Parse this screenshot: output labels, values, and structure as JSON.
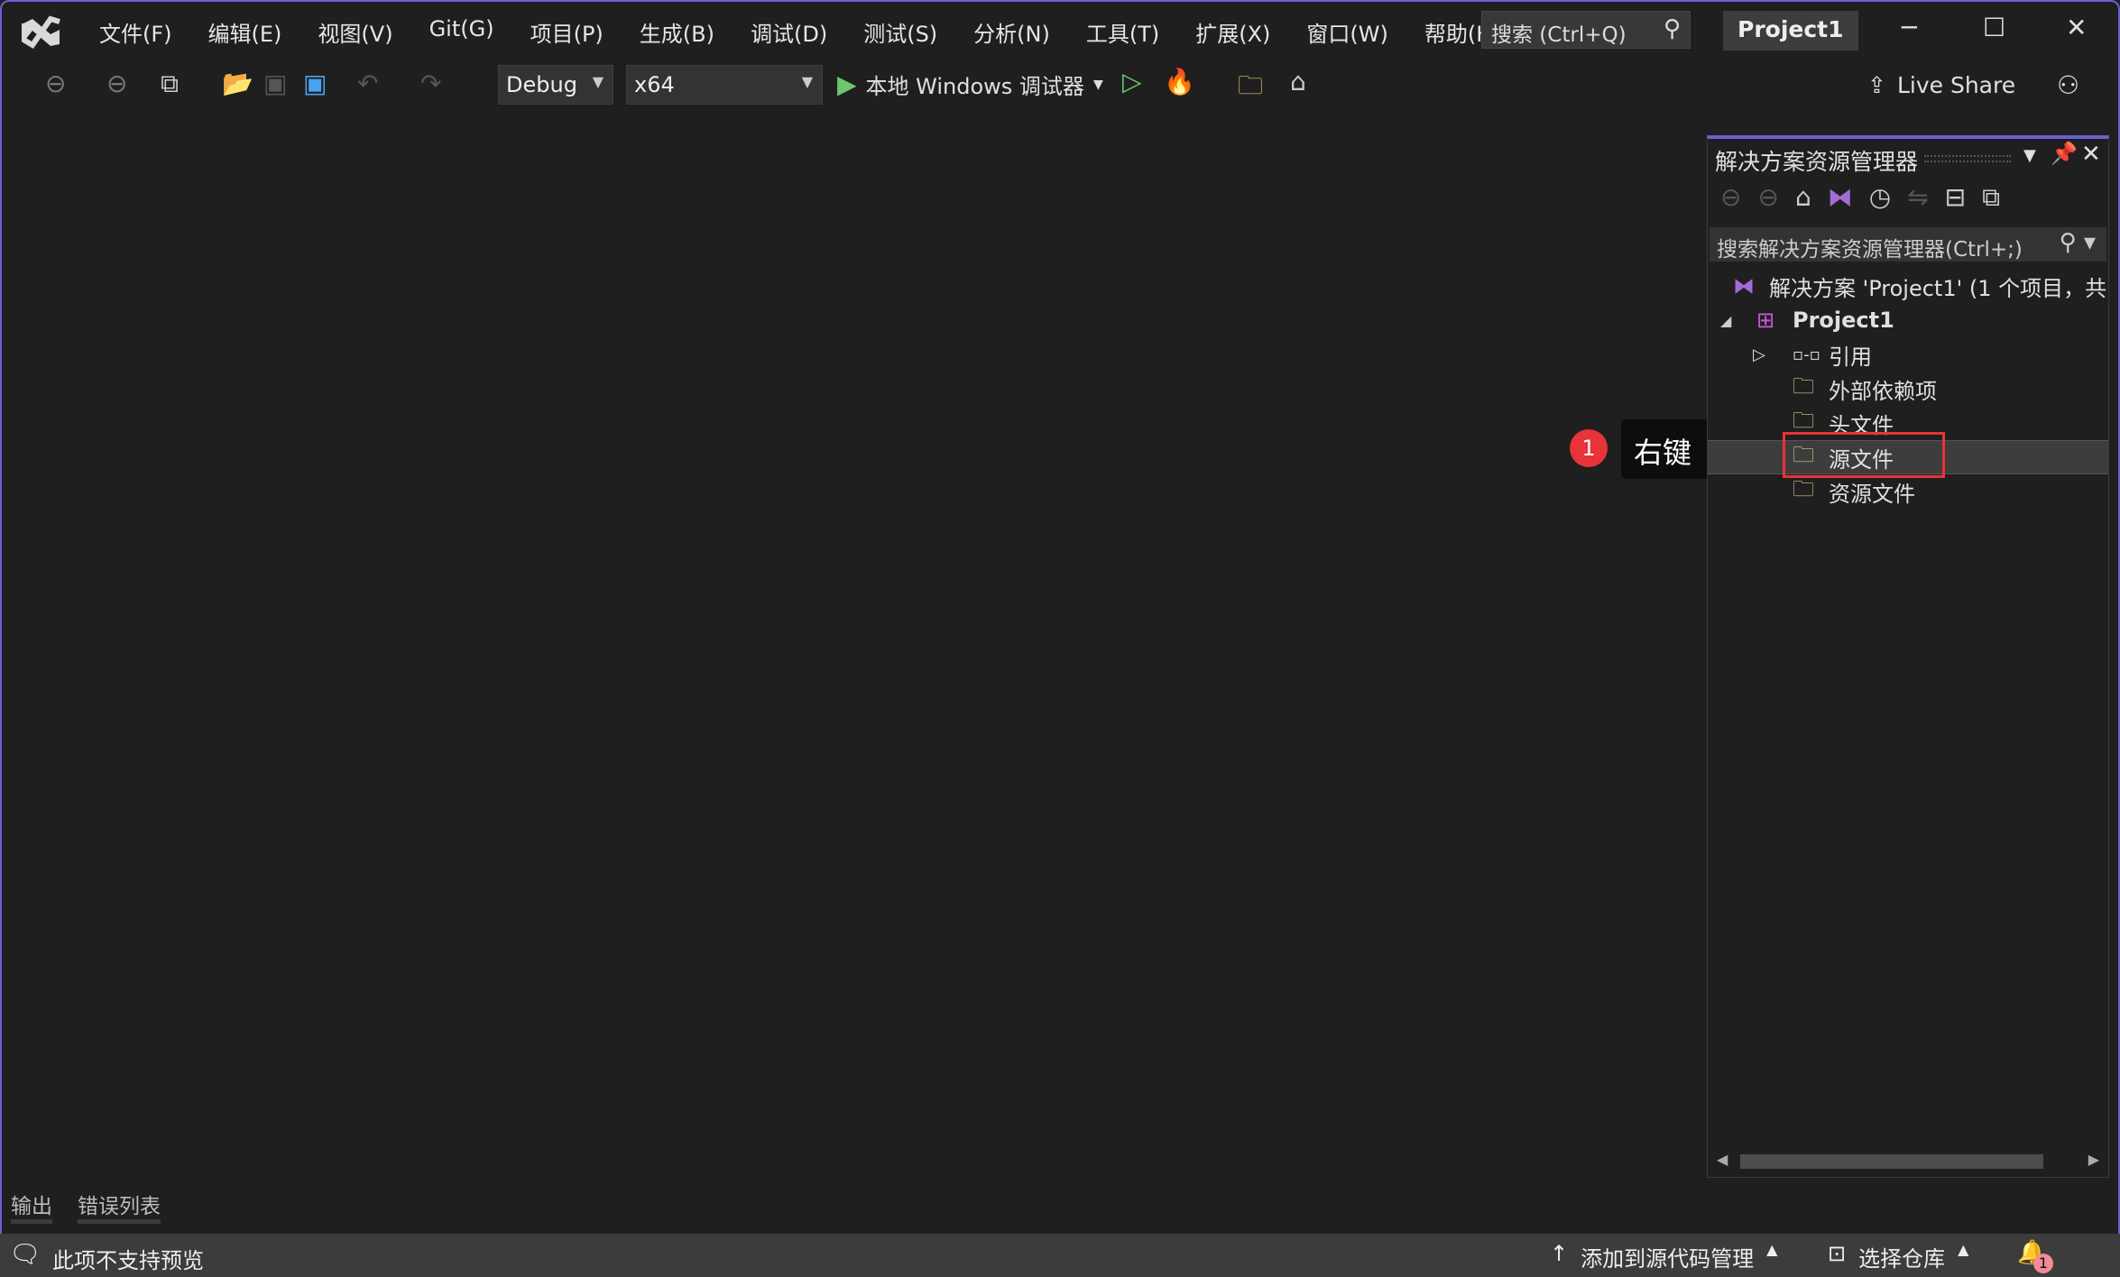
{
  "menu": {
    "items": [
      "文件(F)",
      "编辑(E)",
      "视图(V)",
      "Git(G)",
      "项目(P)",
      "生成(B)",
      "调试(D)",
      "测试(S)",
      "分析(N)",
      "工具(T)",
      "扩展(X)",
      "窗口(W)",
      "帮助(H)"
    ],
    "search_placeholder": "搜索 (Ctrl+Q)",
    "project_badge": "Project1"
  },
  "toolbar": {
    "config": "Debug",
    "platform": "x64",
    "run_label": "本地 Windows 调试器",
    "live_share": "Live Share"
  },
  "solution_explorer": {
    "title": "解决方案资源管理器",
    "search_placeholder": "搜索解决方案资源管理器(Ctrl+;)",
    "tree": [
      {
        "label": "解决方案 'Project1' (1 个项目，共",
        "icon": "solution-icon"
      },
      {
        "label": "Project1",
        "icon": "project-icon",
        "expanded": true
      },
      {
        "label": "引用",
        "icon": "reference-icon",
        "expanded": false
      },
      {
        "label": "外部依赖项",
        "icon": "external-deps-folder-icon"
      },
      {
        "label": "头文件",
        "icon": "filter-folder-icon"
      },
      {
        "label": "源文件",
        "icon": "filter-folder-icon",
        "selected": true
      },
      {
        "label": "资源文件",
        "icon": "filter-folder-icon"
      }
    ]
  },
  "annotation": {
    "step": "1",
    "text": "右键",
    "color": "#e8333a"
  },
  "bottom_tabs": [
    "输出",
    "错误列表"
  ],
  "status": {
    "left": "此项不支持预览",
    "source_control": "添加到源代码管理",
    "repo": "选择仓库",
    "notifications": "1"
  },
  "colors": {
    "accent": "#6b5fd3",
    "background": "#1f1f1f",
    "highlight": "#e8333a"
  }
}
